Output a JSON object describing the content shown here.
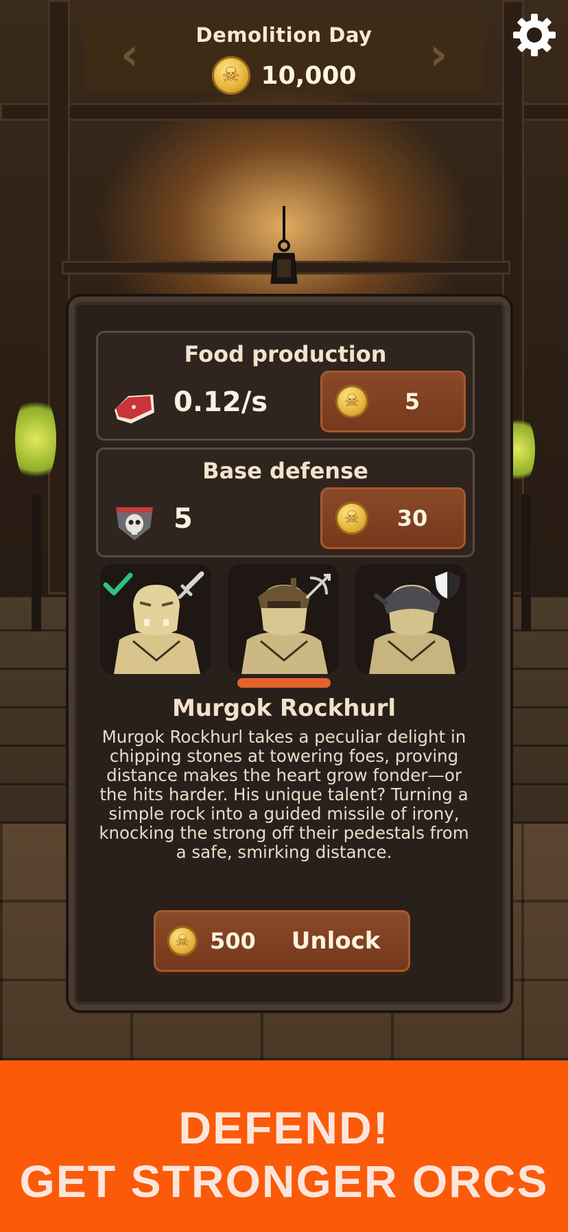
{
  "header": {
    "level_title": "Demolition Day",
    "coins": "10,000",
    "prev_icon": "chevron-left-icon",
    "next_icon": "chevron-right-icon",
    "settings_icon": "gear-icon"
  },
  "food_production": {
    "title": "Food production",
    "value": "0.12/s",
    "icon": "meat-icon",
    "upgrade_cost": "5"
  },
  "base_defense": {
    "title": "Base defense",
    "value": "5",
    "icon": "skull-shield-icon",
    "upgrade_cost": "30"
  },
  "orcs": [
    {
      "class_icon": "sword-icon",
      "owned": true,
      "selected": false
    },
    {
      "class_icon": "crossbow-icon",
      "owned": false,
      "selected": true
    },
    {
      "class_icon": "shield-icon",
      "owned": false,
      "selected": false
    }
  ],
  "selected_orc": {
    "name": "Murgok Rockhurl",
    "description": "Murgok Rockhurl takes a peculiar delight in chipping stones at towering foes, proving distance makes the heart grow fonder—or the hits harder. His unique talent? Turning a simple rock into a guided missile of irony, knocking the strong off their pedestals from a safe, smirking distance."
  },
  "unlock": {
    "price": "500",
    "label": "Unlock"
  },
  "banner": {
    "line1": "DEFEND!",
    "line2": "GET STRONGER ORCS"
  },
  "colors": {
    "accent": "#fb5a09",
    "button": "#7e4121",
    "panel": "#2a201b",
    "coin": "#e6b23a"
  }
}
